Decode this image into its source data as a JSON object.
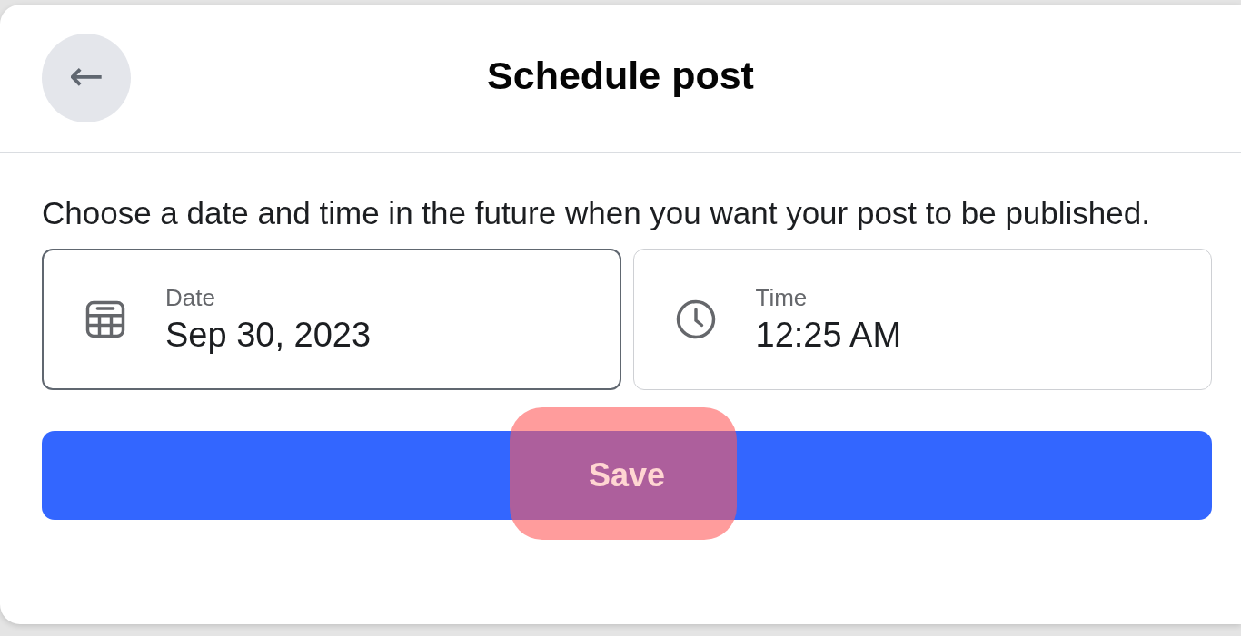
{
  "dialog": {
    "title": "Schedule post",
    "back_button": {
      "label": "←"
    }
  },
  "description": "Choose a date and time in the future when you want your post to be published.",
  "fields": [
    {
      "kind": "date",
      "label": "Date",
      "value": "Sep 30, 2023",
      "focused": true
    },
    {
      "kind": "time",
      "label": "Time",
      "value": "12:25 AM",
      "focused": false
    }
  ],
  "save_button": {
    "label": "Save",
    "highlighted": true
  }
}
